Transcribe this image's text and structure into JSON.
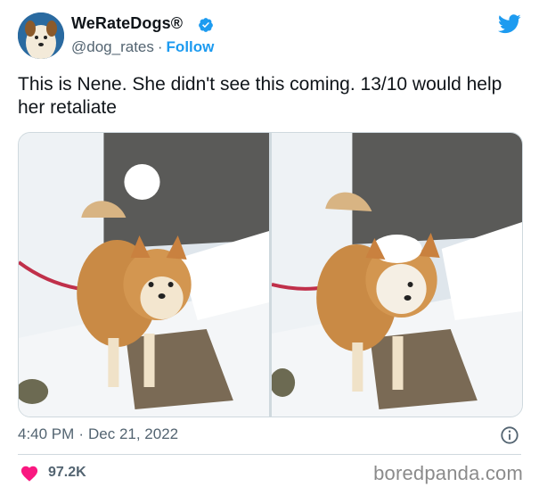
{
  "account": {
    "display_name": "WeRateDogs®",
    "handle": "@dog_rates",
    "separator": "·",
    "follow_label": "Follow"
  },
  "tweet": {
    "text": "This is Nene. She didn't see this coming. 13/10 would help her retaliate",
    "time": "4:40 PM",
    "date_separator": "·",
    "date": "Dec 21, 2022"
  },
  "engagement": {
    "likes": "97.2K"
  },
  "watermark": "boredpanda.com",
  "icons": {
    "verified": "verified-badge-icon",
    "twitter": "twitter-bird-icon",
    "info": "info-icon",
    "like": "heart-icon"
  },
  "colors": {
    "accent": "#1d9bf0",
    "heart": "#f91880",
    "secondary_text": "#536471"
  }
}
